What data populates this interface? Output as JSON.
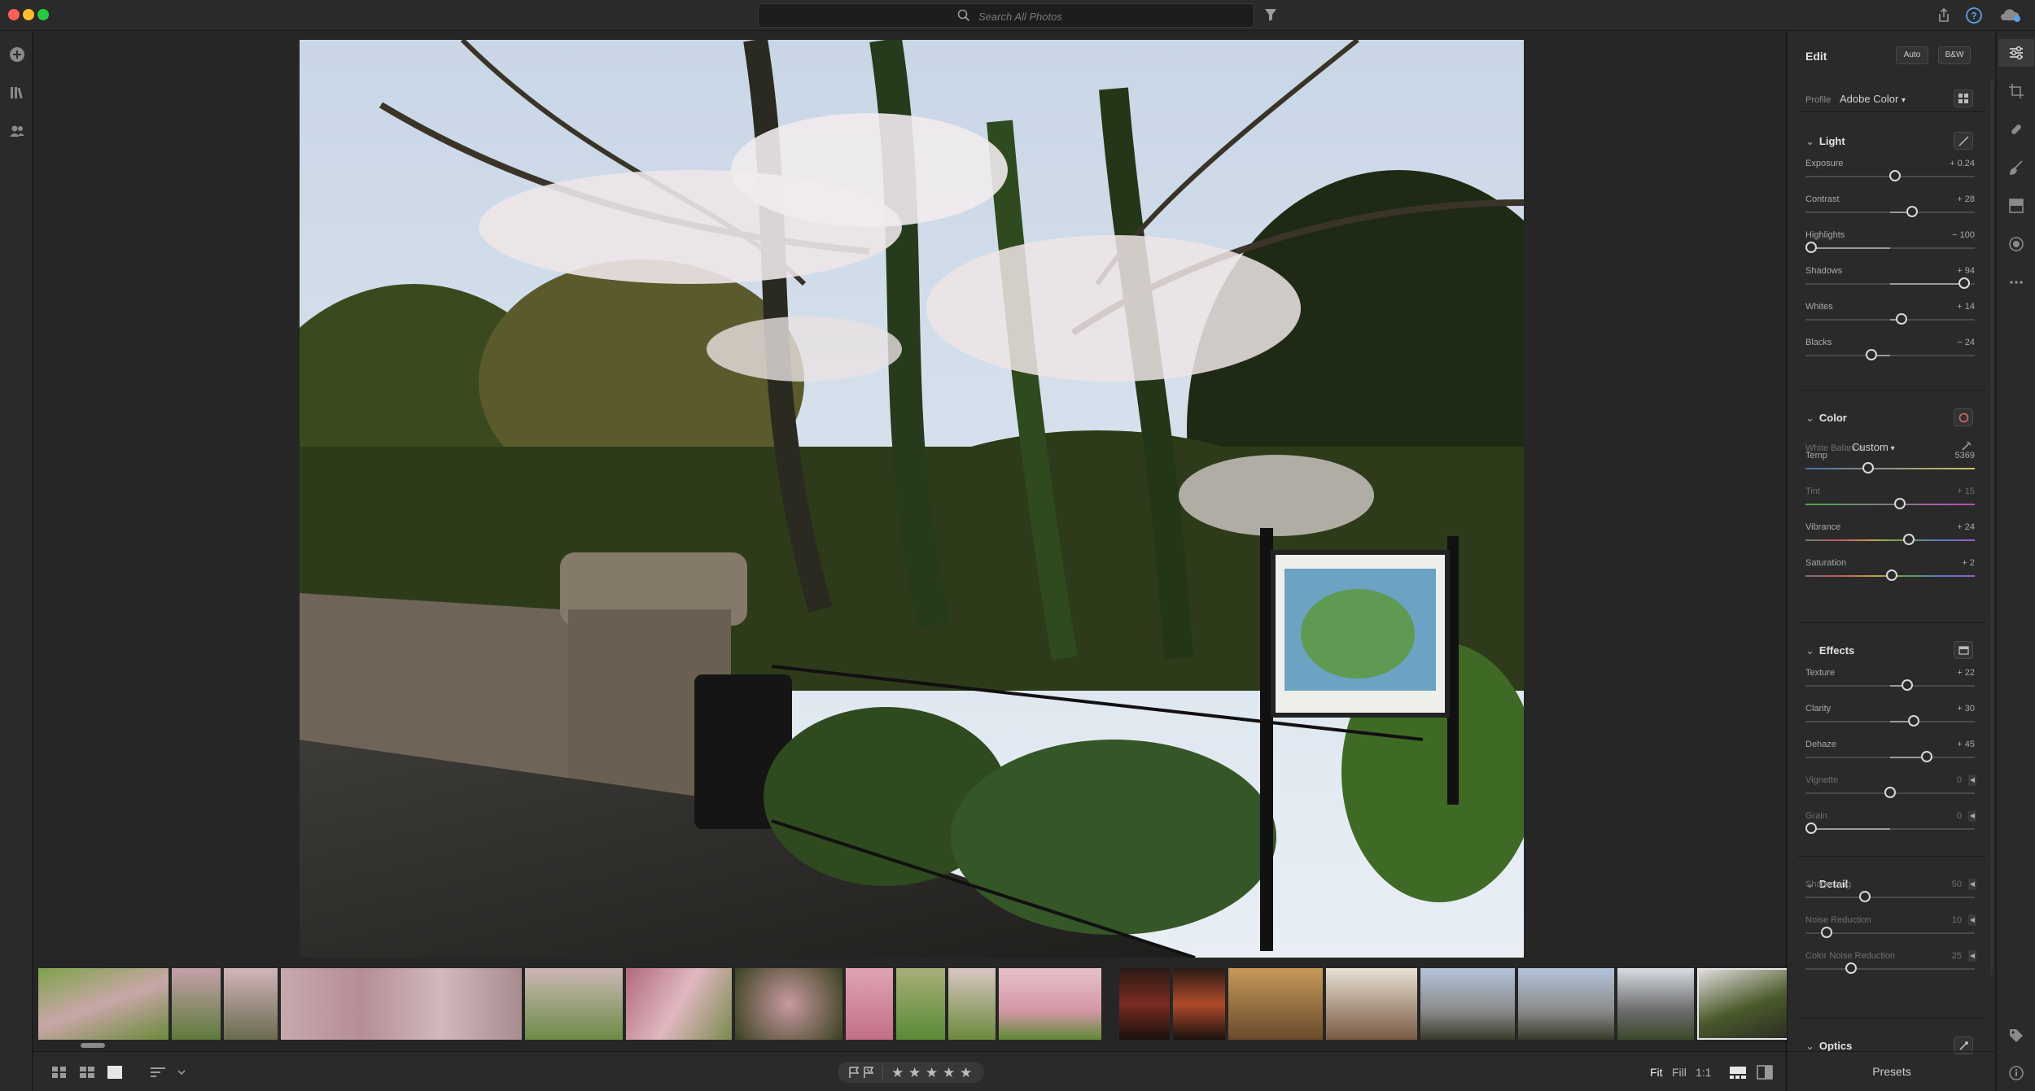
{
  "colors": {
    "close": "#ff5f57",
    "minimize": "#febc2e",
    "maximize": "#28c840",
    "help": "#5aa1e6"
  },
  "search": {
    "placeholder": "Search All Photos"
  },
  "edit_panel": {
    "title": "Edit",
    "auto_label": "Auto",
    "bw_label": "B&W",
    "profile_label": "Profile",
    "profile_value": "Adobe Color",
    "light": {
      "title": "Light",
      "sliders": [
        {
          "label": "Exposure",
          "value": "+ 0.24",
          "pos": 0.53
        },
        {
          "label": "Contrast",
          "value": "+ 28",
          "pos": 0.64
        },
        {
          "label": "Highlights",
          "value": "− 100",
          "pos": 0.0
        },
        {
          "label": "Shadows",
          "value": "+ 94",
          "pos": 0.97
        },
        {
          "label": "Whites",
          "value": "+ 14",
          "pos": 0.57
        },
        {
          "label": "Blacks",
          "value": "− 24",
          "pos": 0.38
        }
      ]
    },
    "color": {
      "title": "Color",
      "wb_label": "White Balance",
      "wb_value": "Custom",
      "sliders": [
        {
          "label": "Temp",
          "value": "5369",
          "pos": 0.36
        },
        {
          "label": "Tint",
          "value": "+ 15",
          "pos": 0.56
        },
        {
          "label": "Vibrance",
          "value": "+ 24",
          "pos": 0.62
        },
        {
          "label": "Saturation",
          "value": "+ 2",
          "pos": 0.51
        }
      ]
    },
    "effects": {
      "title": "Effects",
      "sliders": [
        {
          "label": "Texture",
          "value": "+ 22",
          "pos": 0.61
        },
        {
          "label": "Clarity",
          "value": "+ 30",
          "pos": 0.65
        },
        {
          "label": "Dehaze",
          "value": "+ 45",
          "pos": 0.73
        },
        {
          "label": "Vignette",
          "value": "0",
          "pos": 0.5
        },
        {
          "label": "Grain",
          "value": "0",
          "pos": 0.0
        }
      ]
    },
    "detail": {
      "title": "Detail",
      "sliders": [
        {
          "label": "Sharpening",
          "value": "50",
          "pos": 0.34
        },
        {
          "label": "Noise Reduction",
          "value": "10",
          "pos": 0.1
        },
        {
          "label": "Color Noise Reduction",
          "value": "25",
          "pos": 0.25
        }
      ]
    },
    "optics": {
      "title": "Optics"
    },
    "presets_label": "Presets"
  },
  "bottom_bar": {
    "zoom_fit": "Fit",
    "zoom_fill": "Fill",
    "zoom_1to1": "1:1",
    "stars": [
      "★",
      "★",
      "★",
      "★",
      "★"
    ]
  }
}
